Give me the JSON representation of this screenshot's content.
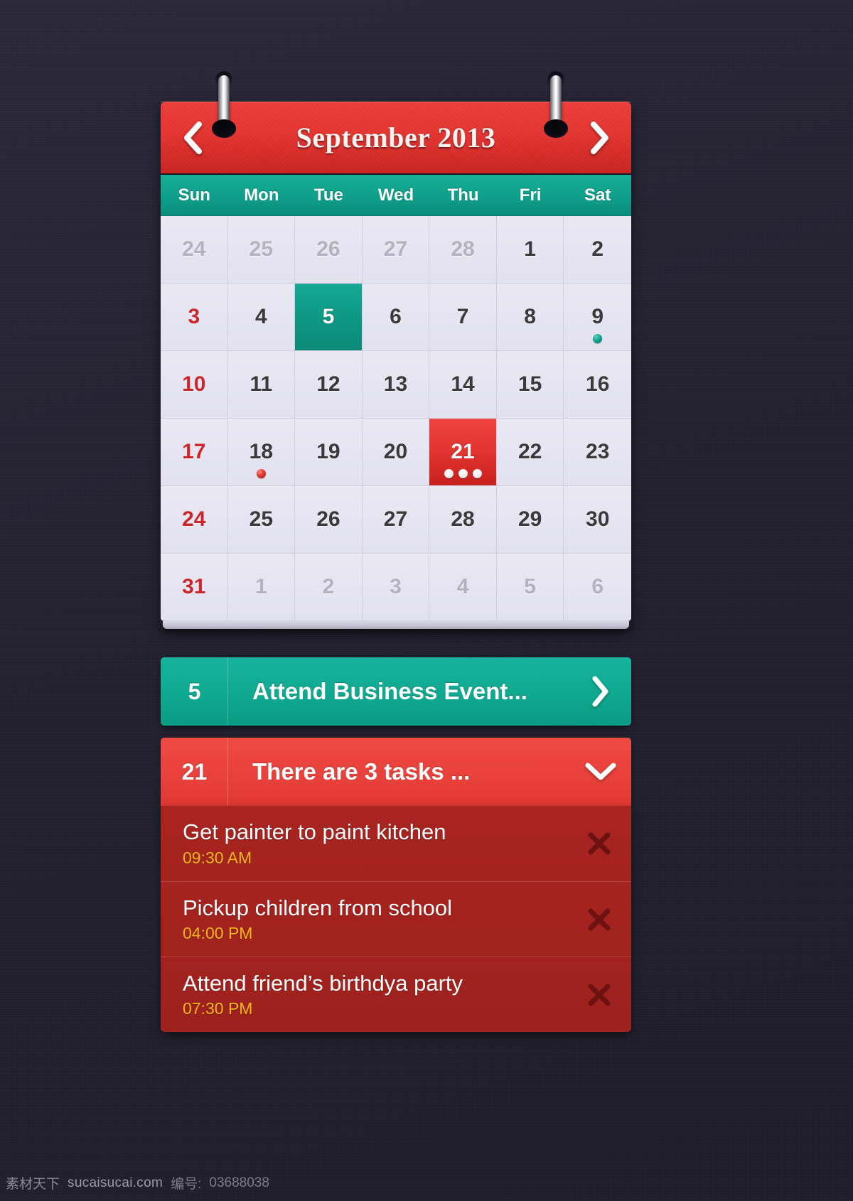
{
  "header": {
    "title": "September 2013",
    "prev_icon": "chevron-left-icon",
    "next_icon": "chevron-right-icon"
  },
  "weekdays": [
    "Sun",
    "Mon",
    "Tue",
    "Wed",
    "Thu",
    "Fri",
    "Sat"
  ],
  "calendar": {
    "month": "September",
    "year": "2013",
    "weeks": [
      [
        {
          "n": "24",
          "state": "muted"
        },
        {
          "n": "25",
          "state": "muted"
        },
        {
          "n": "26",
          "state": "muted"
        },
        {
          "n": "27",
          "state": "muted"
        },
        {
          "n": "28",
          "state": "muted"
        },
        {
          "n": "1",
          "state": "normal"
        },
        {
          "n": "2",
          "state": "normal"
        }
      ],
      [
        {
          "n": "3",
          "state": "sunday"
        },
        {
          "n": "4",
          "state": "normal"
        },
        {
          "n": "5",
          "state": "selected-teal"
        },
        {
          "n": "6",
          "state": "normal"
        },
        {
          "n": "7",
          "state": "normal"
        },
        {
          "n": "8",
          "state": "normal"
        },
        {
          "n": "9",
          "state": "normal",
          "dots": [
            "teal"
          ]
        }
      ],
      [
        {
          "n": "10",
          "state": "sunday"
        },
        {
          "n": "11",
          "state": "normal"
        },
        {
          "n": "12",
          "state": "normal"
        },
        {
          "n": "13",
          "state": "normal"
        },
        {
          "n": "14",
          "state": "normal"
        },
        {
          "n": "15",
          "state": "normal"
        },
        {
          "n": "16",
          "state": "normal"
        }
      ],
      [
        {
          "n": "17",
          "state": "sunday"
        },
        {
          "n": "18",
          "state": "normal",
          "dots": [
            "red"
          ]
        },
        {
          "n": "19",
          "state": "normal"
        },
        {
          "n": "20",
          "state": "normal"
        },
        {
          "n": "21",
          "state": "selected-red",
          "dots": [
            "white",
            "white",
            "white"
          ]
        },
        {
          "n": "22",
          "state": "normal"
        },
        {
          "n": "23",
          "state": "normal"
        }
      ],
      [
        {
          "n": "24",
          "state": "sunday"
        },
        {
          "n": "25",
          "state": "normal"
        },
        {
          "n": "26",
          "state": "normal"
        },
        {
          "n": "27",
          "state": "normal"
        },
        {
          "n": "28",
          "state": "normal"
        },
        {
          "n": "29",
          "state": "normal"
        },
        {
          "n": "30",
          "state": "normal"
        }
      ],
      [
        {
          "n": "31",
          "state": "sunday"
        },
        {
          "n": "1",
          "state": "muted"
        },
        {
          "n": "2",
          "state": "muted"
        },
        {
          "n": "3",
          "state": "muted"
        },
        {
          "n": "4",
          "state": "muted"
        },
        {
          "n": "5",
          "state": "muted"
        },
        {
          "n": "6",
          "state": "muted"
        }
      ]
    ]
  },
  "event_bar": {
    "day": "5",
    "label": "Attend Business Event...",
    "chevron_icon": "chevron-right-icon"
  },
  "tasks_bar": {
    "day": "21",
    "label": "There are 3 tasks ...",
    "chevron_icon": "chevron-down-icon"
  },
  "tasks": [
    {
      "title": "Get painter to paint kitchen",
      "time": "09:30 AM",
      "delete_icon": "close-x-icon"
    },
    {
      "title": "Pickup children from school",
      "time": "04:00 PM",
      "delete_icon": "close-x-icon"
    },
    {
      "title": "Attend friend’s birthdya party",
      "time": "07:30 PM",
      "delete_icon": "close-x-icon"
    }
  ],
  "watermark": {
    "cn": "素材天下",
    "site": "sucaisucai.com",
    "id_label": "编号:",
    "id_value": "03688038"
  },
  "colors": {
    "background": "#262436",
    "header_red": "#e53531",
    "accent_teal": "#0fa88f",
    "selected_red": "#e23430",
    "task_list_red": "#a82420",
    "task_time_amber": "#f5b71a",
    "sunday_red": "#c9272a",
    "cell_bg": "#e7e6f2"
  }
}
